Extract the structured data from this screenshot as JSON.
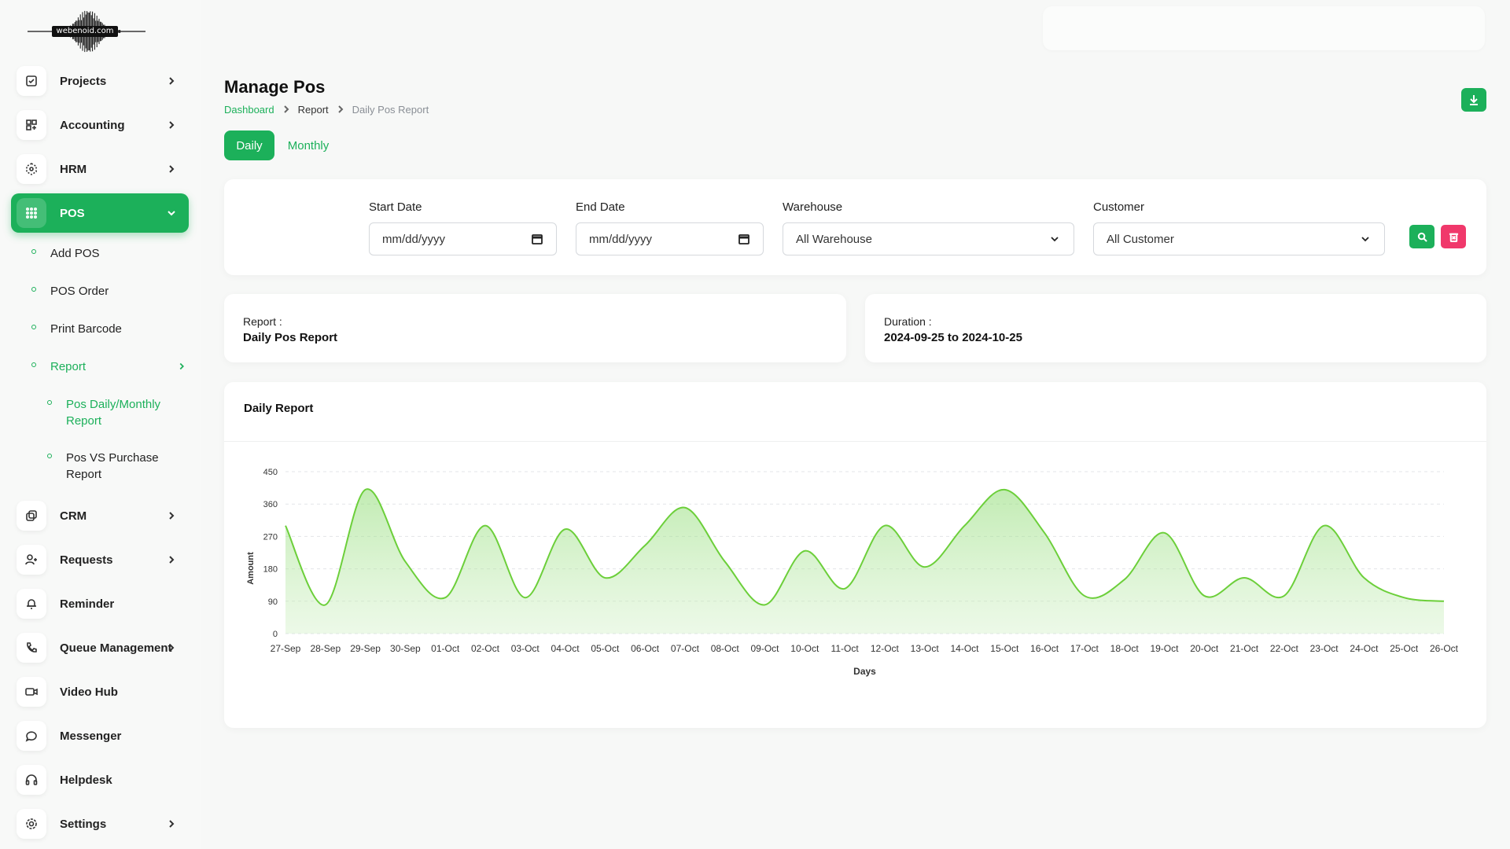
{
  "brand": {
    "logo_text": "webenoid.com"
  },
  "sidebar": {
    "items": [
      {
        "key": "projects",
        "label": "Projects",
        "icon": "checkbox-icon",
        "chevron": true
      },
      {
        "key": "accounting",
        "label": "Accounting",
        "icon": "grid-plus-icon",
        "chevron": true
      },
      {
        "key": "hrm",
        "label": "HRM",
        "icon": "hexagon-icon",
        "chevron": true
      },
      {
        "key": "pos",
        "label": "POS",
        "icon": "grid-dots-icon",
        "chevron": true,
        "active": true
      },
      {
        "key": "crm",
        "label": "CRM",
        "icon": "layers-icon",
        "chevron": true
      },
      {
        "key": "requests",
        "label": "Requests",
        "icon": "user-plus-icon",
        "chevron": true
      },
      {
        "key": "reminder",
        "label": "Reminder",
        "icon": "bell-icon",
        "chevron": false
      },
      {
        "key": "queue",
        "label": "Queue Management",
        "icon": "phone-icon",
        "chevron": true
      },
      {
        "key": "video",
        "label": "Video Hub",
        "icon": "video-icon",
        "chevron": false
      },
      {
        "key": "messenger",
        "label": "Messenger",
        "icon": "chat-icon",
        "chevron": false
      },
      {
        "key": "helpdesk",
        "label": "Helpdesk",
        "icon": "headset-icon",
        "chevron": false
      },
      {
        "key": "settings",
        "label": "Settings",
        "icon": "gear-icon",
        "chevron": true
      }
    ],
    "pos_sub": [
      {
        "label": "Add POS"
      },
      {
        "label": "POS Order"
      },
      {
        "label": "Print Barcode"
      },
      {
        "label": "Report"
      }
    ],
    "report_sub": [
      {
        "label": "Pos Daily/Monthly Report"
      },
      {
        "label": "Pos VS Purchase Report"
      }
    ]
  },
  "page": {
    "title": "Manage Pos",
    "breadcrumb": [
      "Dashboard",
      "Report",
      "Daily Pos Report"
    ]
  },
  "tabs": {
    "daily": "Daily",
    "monthly": "Monthly"
  },
  "filters": {
    "start_label": "Start Date",
    "start_value": "mm/dd/yyyy",
    "end_label": "End Date",
    "end_value": "mm/dd/yyyy",
    "warehouse_label": "Warehouse",
    "warehouse_value": "All Warehouse",
    "customer_label": "Customer",
    "customer_value": "All Customer"
  },
  "report_info": {
    "report_label": "Report :",
    "report_value": "Daily Pos Report",
    "duration_label": "Duration :",
    "duration_value": "2024-09-25 to 2024-10-25"
  },
  "chart_title": "Daily Report",
  "colors": {
    "accent": "#1cb05a",
    "danger": "#f0386b",
    "line": "#6ccf3a"
  },
  "chart_data": {
    "type": "area",
    "title": "Daily Report",
    "xlabel": "Days",
    "ylabel": "Amount",
    "ylim": [
      0,
      450
    ],
    "yticks": [
      0,
      90,
      180,
      270,
      360,
      450
    ],
    "grid": true,
    "categories": [
      "27-Sep",
      "28-Sep",
      "29-Sep",
      "30-Sep",
      "01-Oct",
      "02-Oct",
      "03-Oct",
      "04-Oct",
      "05-Oct",
      "06-Oct",
      "07-Oct",
      "08-Oct",
      "09-Oct",
      "10-Oct",
      "11-Oct",
      "12-Oct",
      "13-Oct",
      "14-Oct",
      "15-Oct",
      "16-Oct",
      "17-Oct",
      "18-Oct",
      "19-Oct",
      "20-Oct",
      "21-Oct",
      "22-Oct",
      "23-Oct",
      "24-Oct",
      "25-Oct",
      "26-Oct"
    ],
    "values": [
      300,
      80,
      400,
      200,
      100,
      300,
      100,
      290,
      155,
      245,
      350,
      200,
      80,
      230,
      125,
      300,
      185,
      300,
      400,
      280,
      105,
      150,
      280,
      105,
      155,
      105,
      300,
      155,
      100,
      90
    ]
  }
}
